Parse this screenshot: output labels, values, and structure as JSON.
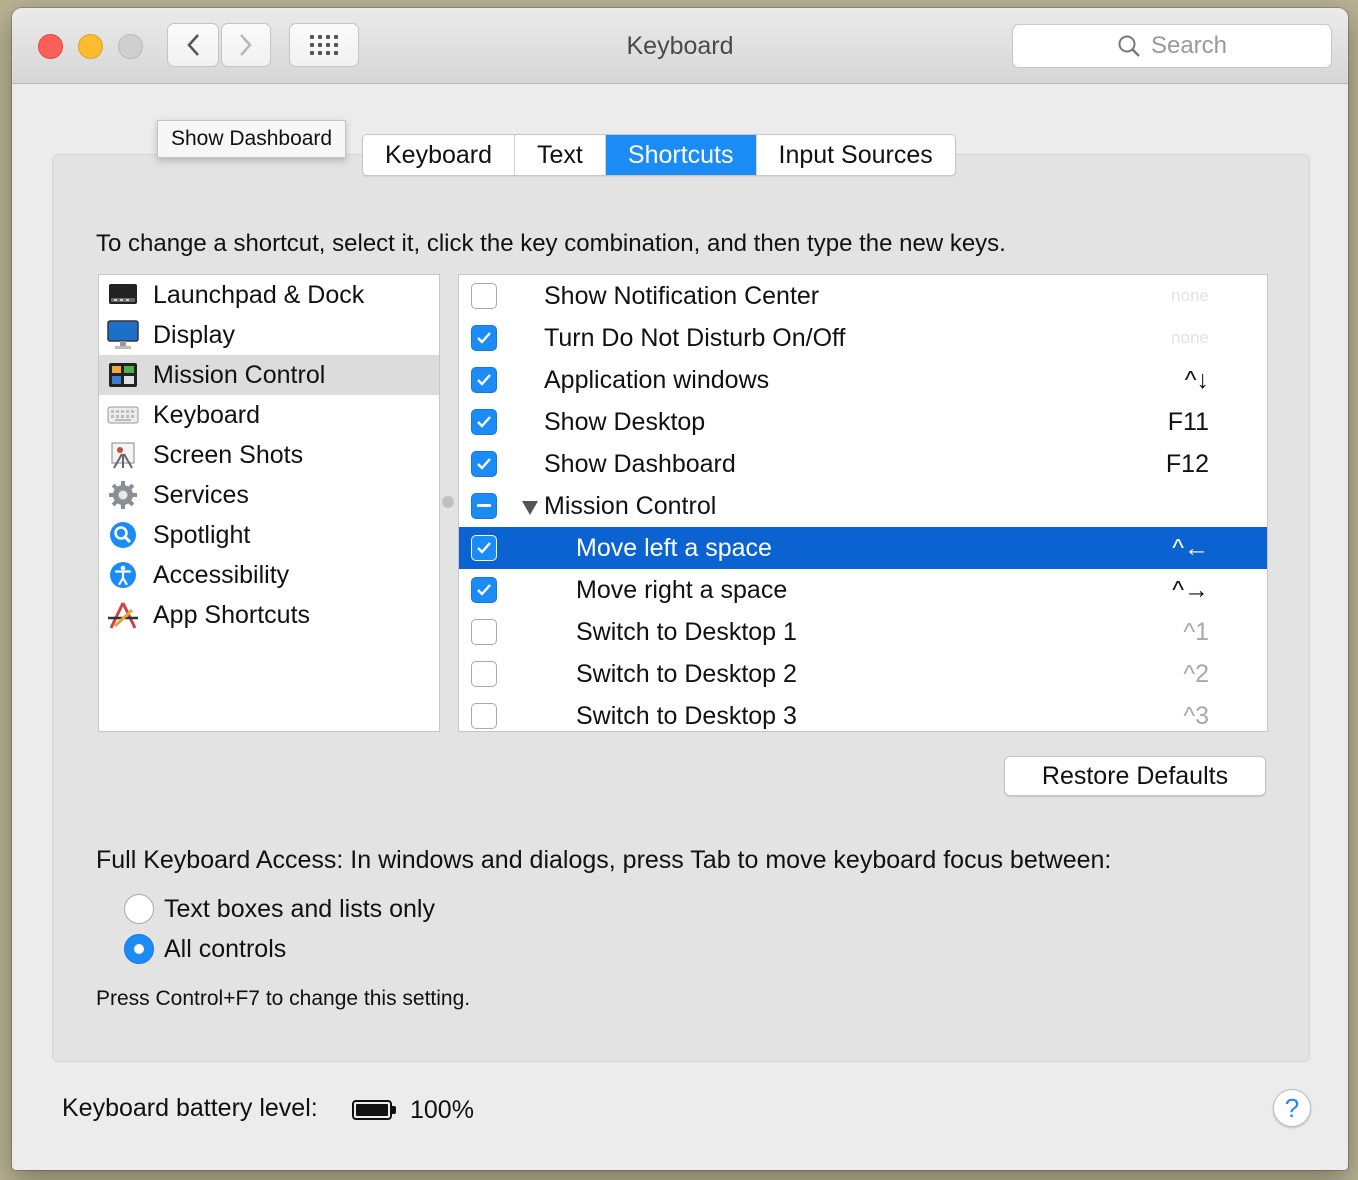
{
  "window": {
    "title": "Keyboard"
  },
  "toolbar": {
    "back_icon": "chevron-left-icon",
    "forward_icon": "chevron-right-icon",
    "show_all_icon": "grid-icon"
  },
  "search": {
    "placeholder": "Search"
  },
  "tooltip": "Show Dashboard",
  "tabs": [
    {
      "label": "Keyboard",
      "active": false
    },
    {
      "label": "Text",
      "active": false
    },
    {
      "label": "Shortcuts",
      "active": true
    },
    {
      "label": "Input Sources",
      "active": false
    }
  ],
  "instruction": "To change a shortcut, select it, click the key combination, and then type the new keys.",
  "categories": [
    {
      "label": "Launchpad & Dock",
      "icon": "launchpad-dock-icon",
      "selected": false
    },
    {
      "label": "Display",
      "icon": "display-icon",
      "selected": false
    },
    {
      "label": "Mission Control",
      "icon": "mission-control-icon",
      "selected": true
    },
    {
      "label": "Keyboard",
      "icon": "keyboard-icon",
      "selected": false
    },
    {
      "label": "Screen Shots",
      "icon": "screen-shots-icon",
      "selected": false
    },
    {
      "label": "Services",
      "icon": "services-gear-icon",
      "selected": false
    },
    {
      "label": "Spotlight",
      "icon": "spotlight-icon",
      "selected": false
    },
    {
      "label": "Accessibility",
      "icon": "accessibility-icon",
      "selected": false
    },
    {
      "label": "App Shortcuts",
      "icon": "app-shortcuts-icon",
      "selected": false
    }
  ],
  "shortcuts": [
    {
      "label": "Show Notification Center",
      "key": "none",
      "checked": false
    },
    {
      "label": "Turn Do Not Disturb On/Off",
      "key": "none",
      "checked": true
    },
    {
      "label": "Application windows",
      "key": "^↓",
      "checked": true
    },
    {
      "label": "Show Desktop",
      "key": "F11",
      "checked": true
    },
    {
      "label": "Show Dashboard",
      "key": "F12",
      "checked": true
    },
    {
      "label": "Mission Control",
      "key": "",
      "state": "mixed",
      "expanded": true
    },
    {
      "label": "Move left a space",
      "key": "^←",
      "checked": true,
      "selected": true
    },
    {
      "label": "Move right a space",
      "key": "^→",
      "checked": true
    },
    {
      "label": "Switch to Desktop 1",
      "key": "^1",
      "checked": false
    },
    {
      "label": "Switch to Desktop 2",
      "key": "^2",
      "checked": false
    },
    {
      "label": "Switch to Desktop 3",
      "key": "^3",
      "checked": false
    }
  ],
  "restore_defaults": "Restore Defaults",
  "full_keyboard_access": {
    "label": "Full Keyboard Access: In windows and dialogs, press Tab to move keyboard focus between:",
    "options": [
      {
        "label": "Text boxes and lists only",
        "selected": false
      },
      {
        "label": "All controls",
        "selected": true
      }
    ],
    "note": "Press Control+F7 to change this setting."
  },
  "battery": {
    "label": "Keyboard battery level:",
    "value": "100%",
    "level": 1.0
  },
  "help": "?",
  "colors": {
    "accent": "#1b8cf6",
    "selection": "#0b63d1",
    "close": "#fc5f57",
    "minimize": "#fdbc2e"
  }
}
